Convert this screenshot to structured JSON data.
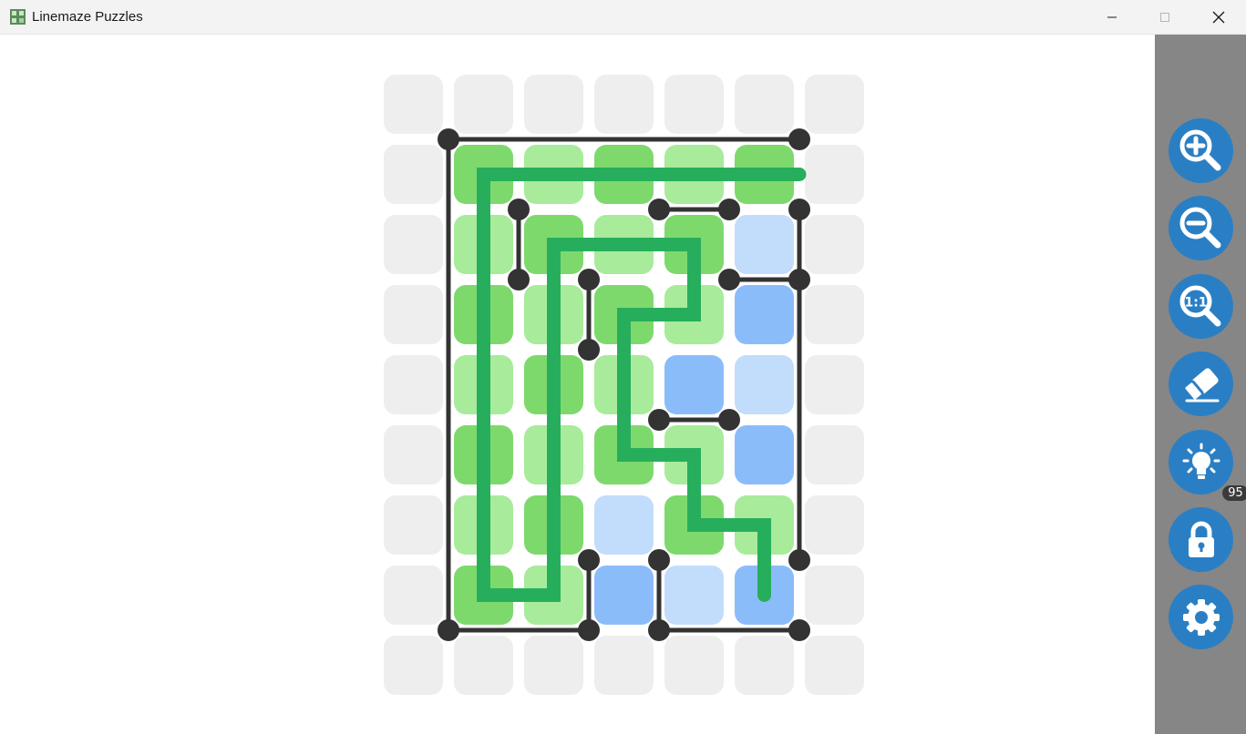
{
  "window": {
    "title": "Linemaze Puzzles"
  },
  "toolbar": {
    "buttons": [
      {
        "name": "zoom-in",
        "icon": "zoom-in-icon"
      },
      {
        "name": "zoom-out",
        "icon": "zoom-out-icon"
      },
      {
        "name": "zoom-reset",
        "icon": "zoom-1to1-icon",
        "label": "1:1"
      },
      {
        "name": "eraser",
        "icon": "eraser-icon"
      },
      {
        "name": "hint",
        "icon": "lightbulb-icon",
        "badge": "95"
      },
      {
        "name": "lock",
        "icon": "lock-icon"
      },
      {
        "name": "settings",
        "icon": "gear-icon"
      }
    ]
  },
  "colors": {
    "empty": "#eeeeee",
    "green_dark": "#7ed96d",
    "green_light": "#a8eb9a",
    "blue_dark": "#8bbcfa",
    "blue_light": "#c2dcfc",
    "path": "#27ae5c",
    "wall": "#333333",
    "sidebar": "#868686",
    "button": "#2a7fc4"
  },
  "board": {
    "cols": 7,
    "rows": 9,
    "cells": [
      "EEEEEEE",
      "EGgGgGE",
      "EgGgGbE",
      "EGgGgBE",
      "EgGgBbE",
      "EGgGgBE",
      "EgGbGgE",
      "EGgBbBE",
      "EEEEEEE"
    ],
    "walls": [
      [
        [
          1,
          1
        ],
        [
          6,
          1
        ]
      ],
      [
        [
          1,
          1
        ],
        [
          1,
          8
        ]
      ],
      [
        [
          1,
          8
        ],
        [
          3,
          8
        ]
      ],
      [
        [
          4,
          8
        ],
        [
          6,
          8
        ]
      ],
      [
        [
          6,
          2
        ],
        [
          6,
          7
        ]
      ],
      [
        [
          2,
          2
        ],
        [
          2,
          3
        ]
      ],
      [
        [
          4,
          2
        ],
        [
          5,
          2
        ]
      ],
      [
        [
          5,
          3
        ],
        [
          6,
          3
        ]
      ],
      [
        [
          3,
          3
        ],
        [
          3,
          4
        ]
      ],
      [
        [
          4,
          5
        ],
        [
          5,
          5
        ]
      ],
      [
        [
          3,
          7
        ],
        [
          3,
          8
        ]
      ],
      [
        [
          4,
          7
        ],
        [
          4,
          8
        ]
      ]
    ],
    "dots": [
      [
        1,
        1
      ],
      [
        6,
        1
      ],
      [
        2,
        2
      ],
      [
        4,
        2
      ],
      [
        5,
        2
      ],
      [
        6,
        2
      ],
      [
        2,
        3
      ],
      [
        3,
        3
      ],
      [
        5,
        3
      ],
      [
        6,
        3
      ],
      [
        3,
        4
      ],
      [
        4,
        5
      ],
      [
        5,
        5
      ],
      [
        3,
        7
      ],
      [
        4,
        7
      ],
      [
        6,
        7
      ],
      [
        1,
        8
      ],
      [
        3,
        8
      ],
      [
        4,
        8
      ],
      [
        6,
        8
      ]
    ],
    "path": [
      [
        6.0,
        1.5
      ],
      [
        1.5,
        1.5
      ],
      [
        1.5,
        7.5
      ],
      [
        2.5,
        7.5
      ],
      [
        2.5,
        2.5
      ],
      [
        4.5,
        2.5
      ],
      [
        4.5,
        3.5
      ],
      [
        3.5,
        3.5
      ],
      [
        3.5,
        5.5
      ],
      [
        4.5,
        5.5
      ],
      [
        4.5,
        6.5
      ],
      [
        5.5,
        6.5
      ],
      [
        5.5,
        7.5
      ]
    ]
  }
}
